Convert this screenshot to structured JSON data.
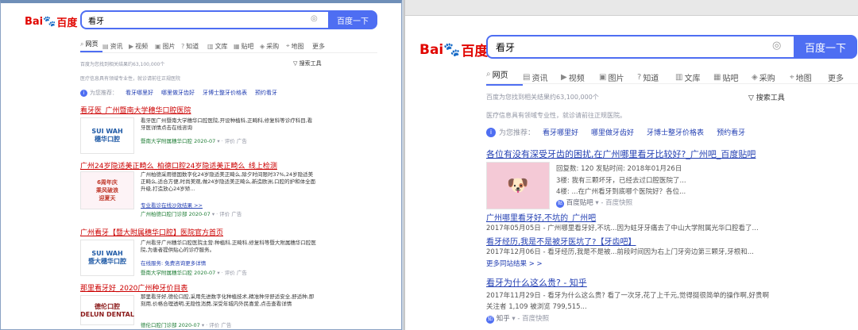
{
  "search": {
    "query": "看牙",
    "button_label": "百度一下"
  },
  "tabs": [
    "网页",
    "资讯",
    "视频",
    "图片",
    "知道",
    "文库",
    "贴吧",
    "采购",
    "地图",
    "更多"
  ],
  "result_count_left": "百度为您找到相关结果约63,100,000个",
  "result_count_right": "百度为您找到相关结果约63,100,000个",
  "tools_label": "搜索工具",
  "medical_note": "医疗信息具有领域专业性，就诊请前往正规医院",
  "medical_note_right": "医疗信息具有领域专业性，就诊请前往正规医院。",
  "recommend": {
    "label": "为您推荐：",
    "items": [
      "看牙哪里好",
      "哪里做牙齿好",
      "牙博士整牙价格表",
      "预约看牙"
    ]
  },
  "left_results": [
    {
      "title": "看牙医_广州暨南大学穗华口腔医院",
      "snippet": "看牙医广州暨南大学穗华口腔医院,开设种植科,正畸科,修复科等诊疗科目,看牙医详情点击在线咨询",
      "source": "暨南大学附属穗华口腔",
      "date": "2020-07",
      "ad": "广告",
      "logo": "SUI WAH\n穗华口腔"
    },
    {
      "title": "广州24岁隐适美正畸么_柏德口腔24岁隐适美正畸么_线上检测",
      "snippet": "广州柏德采用德国数字化24岁隐适美正畸么,除夕时间限时37%,24岁隐适美正畸么,适合方便,时尚美观,做24岁隐适美正畸么,新造欧洲,口腔的护和体全面升级,打造放心24岁矫...",
      "link": "专业看诊在线沙效结果 >>",
      "source": "广州柏德口腔门诊部",
      "date": "2020-07",
      "ad": "广告",
      "logo": "6周年庆\n乘风破浪\n迎夏天"
    },
    {
      "title": "广州看牙【暨大附属穗华口腔】医院官方首页",
      "snippet": "广州看牙广州穗华口腔医院主营:种植科,正畸科,修复科等暨大附属穗华口腔医院,为患者提供贴心的诊疗服务。",
      "extra": "在线服务: 免费咨询更多详情",
      "source": "暨南大学附属穗华口腔",
      "date": "2020-07",
      "ad": "广告",
      "logo": "SUI WAH\n暨大穗华口腔"
    },
    {
      "title": "那里看牙好_2020广州种牙价目表",
      "snippet": "那里看牙好,德伦口腔,采用先进数字化种植技术,精准种牙舒适安全,舒适种,即刻用,价格合理透明,无隐性消费,深受年城内外民喜爱,点击查看详情",
      "source": "德伦口腔门诊部",
      "date": "2020-07",
      "ad": "广告",
      "logo": "德伦口腔\nDELUN DENTAL"
    }
  ],
  "right_results": [
    {
      "title": "各位有没有深受牙齿的困扰,在广州哪里看牙比较好?_广州吧_百度贴吧",
      "line1": "回复数: 120 发贴时间: 2018年01月26日",
      "line2": "3楼: 我有三颗坏牙，已经去过口腔医院了...",
      "line3": "4楼: ...在广州看牙到底哪个医院好？各位...",
      "source": "百度贴吧",
      "snap": "百度快照"
    },
    {
      "title": "广州哪里看牙好,不坑的_广州吧",
      "snippet": "2017年05月05日 - 广州哪里看牙好,不坑...因为蛀牙牙痛去了中山大学附属光华口腔看了..."
    },
    {
      "title": "看牙经历,我是不是被牙医坑了?【牙齿吧】",
      "snippet": "2017年12月06日 - 看牙经历,我是不是被...前段时间因为右上门牙旁边第三颗牙,牙根和...",
      "more": "更多同站结果 > >"
    },
    {
      "title": "看牙为什么这么贵? - 知乎",
      "snippet": "2017年11月29日 - 看牙为什么这么贵? 看了一次牙,花了上千元,觉得挺很简单的操作啊,好贵啊",
      "line2": "关注者 1,109 被浏览 799,515...",
      "source": "知乎",
      "snap": "百度快照"
    }
  ],
  "colors": {
    "accent": "#4e6ef2",
    "link": "#2440b3",
    "highlight": "#f73131",
    "baidu_red": "#e10601"
  }
}
